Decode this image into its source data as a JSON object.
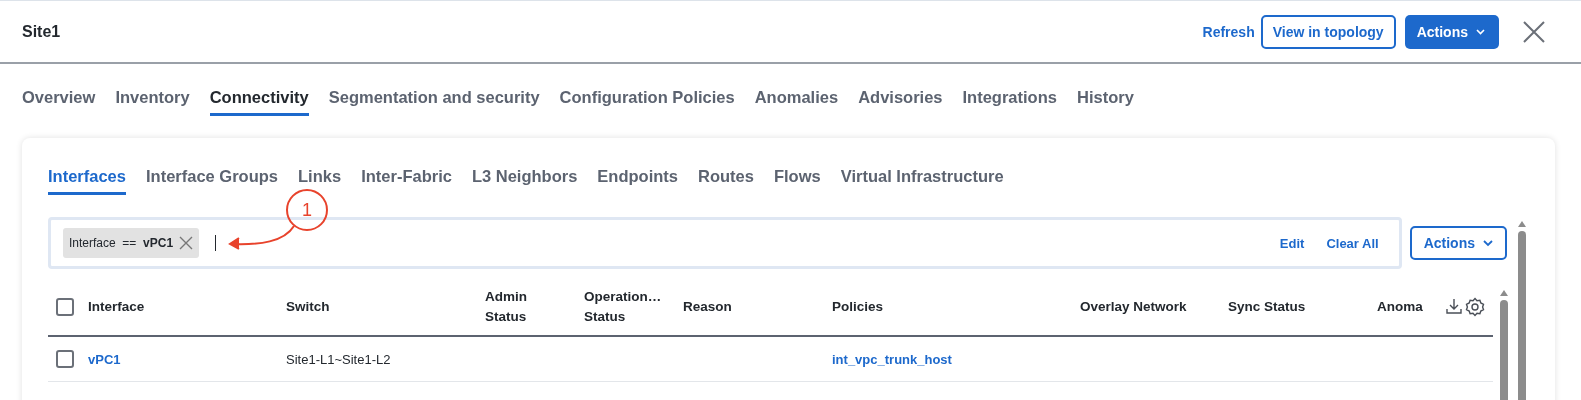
{
  "window": {
    "title": "Site1"
  },
  "header_actions": {
    "refresh": "Refresh",
    "view_topology": "View in topology",
    "actions": "Actions"
  },
  "tabs": [
    {
      "label": "Overview",
      "selected": false
    },
    {
      "label": "Inventory",
      "selected": false
    },
    {
      "label": "Connectivity",
      "selected": true
    },
    {
      "label": "Segmentation and security",
      "selected": false
    },
    {
      "label": "Configuration Policies",
      "selected": false
    },
    {
      "label": "Anomalies",
      "selected": false
    },
    {
      "label": "Advisories",
      "selected": false
    },
    {
      "label": "Integrations",
      "selected": false
    },
    {
      "label": "History",
      "selected": false
    }
  ],
  "subtabs": [
    {
      "label": "Interfaces",
      "selected": true
    },
    {
      "label": "Interface Groups",
      "selected": false
    },
    {
      "label": "Links",
      "selected": false
    },
    {
      "label": "Inter-Fabric",
      "selected": false
    },
    {
      "label": "L3 Neighbors",
      "selected": false
    },
    {
      "label": "Endpoints",
      "selected": false
    },
    {
      "label": "Routes",
      "selected": false
    },
    {
      "label": "Flows",
      "selected": false
    },
    {
      "label": "Virtual Infrastructure",
      "selected": false
    }
  ],
  "filter": {
    "chips": [
      {
        "field": "Interface",
        "operator": "==",
        "value": "vPC1"
      }
    ],
    "edit": "Edit",
    "clear_all": "Clear All"
  },
  "annotation": {
    "label": "1"
  },
  "table_actions": "Actions",
  "table": {
    "all_selected": false,
    "columns": [
      {
        "kind": "link",
        "label": "Interface"
      },
      {
        "kind": "text",
        "label": "Switch"
      },
      {
        "kind": "text",
        "label": "Admin Status"
      },
      {
        "kind": "text",
        "label": "Operation… Status"
      },
      {
        "kind": "text",
        "label": "Reason"
      },
      {
        "kind": "link",
        "label": "Policies"
      },
      {
        "kind": "text",
        "label": "Overlay Network"
      },
      {
        "kind": "text",
        "label": "Sync Status"
      },
      {
        "kind": "text",
        "label": "Anoma"
      }
    ],
    "rows": [
      {
        "selected": false,
        "cells": [
          "vPC1",
          "Site1-L1~Site1-L2",
          null,
          null,
          null,
          "int_vpc_trunk_host",
          null,
          null,
          null
        ]
      }
    ]
  }
}
